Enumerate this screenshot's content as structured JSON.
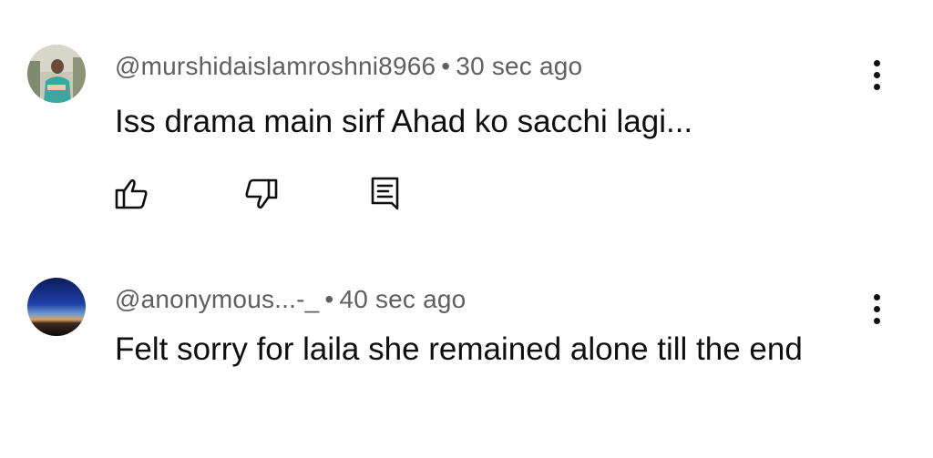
{
  "comments": [
    {
      "handle": "@murshidaislamroshni8966",
      "separator": "•",
      "time": "30 sec ago",
      "text": "Iss drama main sirf Ahad ko sacchi lagi...",
      "avatar_icon": "profile-photo-person",
      "actions": [
        "like-icon",
        "dislike-icon",
        "reply-icon"
      ]
    },
    {
      "handle": "@anonymous...-_",
      "separator": "•",
      "time": "40 sec ago",
      "text": "Felt sorry for laila she remained alone till the end",
      "avatar_icon": "profile-photo-horizon"
    }
  ],
  "colors": {
    "meta_text": "#606060",
    "body_text": "#0f0f0f",
    "background": "#ffffff"
  }
}
